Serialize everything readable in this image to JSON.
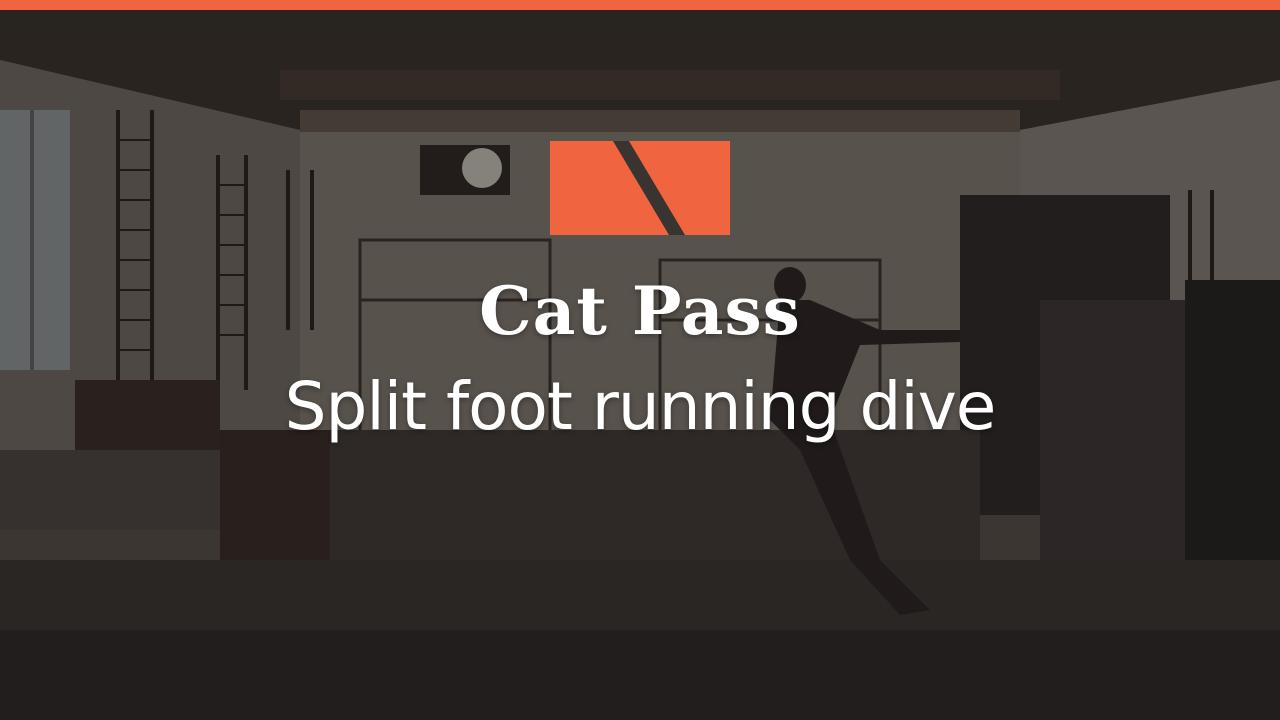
{
  "title": "Cat Pass",
  "subtitle": "Split foot running dive",
  "colors": {
    "accent": "#f0643f",
    "text": "#ffffff"
  },
  "icons": {
    "logo": "brand-logo-icon"
  }
}
